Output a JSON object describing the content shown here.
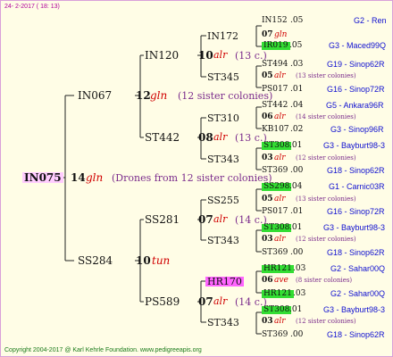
{
  "header": {
    "date": "24-  2-2017 ( 18: 13)"
  },
  "footer": {
    "copyright": "Copyright 2004-2017 @ Karl Kehrle Foundation.   www.pedigreeapis.org"
  },
  "root": {
    "id": "IN075",
    "year": "14",
    "breed": "gln",
    "note": "(Drones from 12 sister colonies)"
  },
  "gen1": {
    "father": {
      "id": "IN067",
      "year": "12",
      "breed": "gln",
      "note": "(12 sister colonies)"
    },
    "mother": {
      "id": "SS284",
      "year": "10",
      "breed": "tun"
    }
  },
  "gen2": [
    {
      "id": "IN120",
      "year": "10",
      "breed": "alr",
      "note": "(13 c.)"
    },
    {
      "id": "ST442",
      "year": "08",
      "breed": "alr",
      "note": "(13 c.)"
    },
    {
      "id": "SS281",
      "year": "07",
      "breed": "alr",
      "note": "(14 c.)"
    },
    {
      "id": "PS589",
      "year": "07",
      "breed": "alr",
      "note": "(14 c.)"
    }
  ],
  "gen3": [
    {
      "id": "IN172",
      "year": "07",
      "breed": "gln"
    },
    {
      "id": "ST345",
      "year": "05",
      "breed": "alr",
      "note": "(13 sister colonies)"
    },
    {
      "id": "ST310",
      "year": "06",
      "breed": "alr",
      "note": "(14 sister colonies)"
    },
    {
      "id": "ST343",
      "year": "03",
      "breed": "alr",
      "note": "(12 sister colonies)"
    },
    {
      "id": "SS255",
      "year": "05",
      "breed": "alr",
      "note": "(13 sister colonies)"
    },
    {
      "id": "ST343",
      "year": "03",
      "breed": "alr",
      "note": "(12 sister colonies)"
    },
    {
      "id": "HR170",
      "year": "06",
      "breed": "ave",
      "note": "(8 sister colonies)"
    },
    {
      "id": "ST343",
      "year": "03",
      "breed": "alr",
      "note": "(12 sister colonies)"
    }
  ],
  "gen4": [
    {
      "id": "IN152",
      "suffix": ".05",
      "loc": "G2 - Ren"
    },
    {
      "id": "IR019",
      "suffix": ".05",
      "loc": "G3 - Maced99Q"
    },
    {
      "id": "ST494",
      "suffix": ".03",
      "loc": "G19 - Sinop62R"
    },
    {
      "id": "PS017",
      "suffix": ".01",
      "loc": "G16 - Sinop72R"
    },
    {
      "id": "ST442",
      "suffix": ".04",
      "loc": "G5 - Ankara96R"
    },
    {
      "id": "KB107",
      "suffix": ".02",
      "loc": "G3 - Sinop96R"
    },
    {
      "id": "ST308",
      "suffix": ".01",
      "loc": "G3 - Bayburt98-3"
    },
    {
      "id": "ST369",
      "suffix": ".00",
      "loc": "G18 - Sinop62R"
    },
    {
      "id": "SS298",
      "suffix": ".04",
      "loc": "G1 - Carnic03R"
    },
    {
      "id": "PS017",
      "suffix": ".01",
      "loc": "G16 - Sinop72R"
    },
    {
      "id": "ST308",
      "suffix": ".01",
      "loc": "G3 - Bayburt98-3"
    },
    {
      "id": "ST369",
      "suffix": ".00",
      "loc": "G18 - Sinop62R"
    },
    {
      "id": "HR121",
      "suffix": ".03",
      "loc": "G2 - Sahar00Q"
    },
    {
      "id": "HR121",
      "suffix": ".03",
      "loc": "G2 - Sahar00Q"
    },
    {
      "id": "ST308",
      "suffix": ".01",
      "loc": "G3 - Bayburt98-3"
    },
    {
      "id": "ST369",
      "suffix": ".00",
      "loc": "G18 - Sinop62R"
    }
  ],
  "colors": {
    "line": "#222222",
    "highlight_green": "#33dd33",
    "highlight_pink": "#ff66ff",
    "breed_red": "#d00000",
    "note_purple": "#7b2c8c",
    "loc_blue": "#1010d0"
  }
}
